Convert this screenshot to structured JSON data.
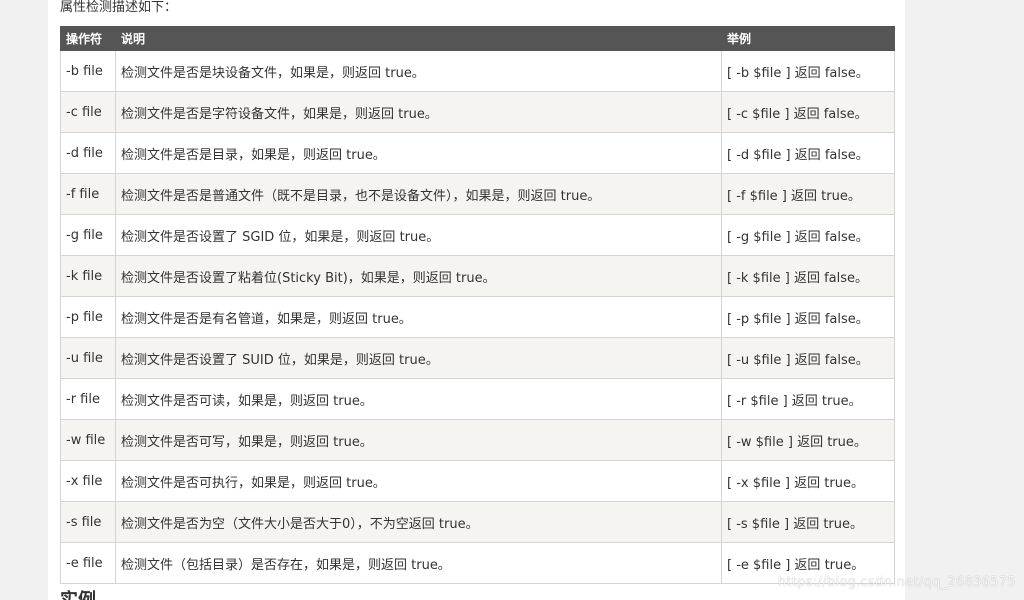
{
  "intro": "属性检测描述如下：",
  "table": {
    "headers": [
      "操作符",
      "说明",
      "举例"
    ],
    "rows": [
      {
        "op": "-b file",
        "desc": "检测文件是否是块设备文件，如果是，则返回 true。",
        "example": "[ -b $file ] 返回 false。"
      },
      {
        "op": "-c file",
        "desc": "检测文件是否是字符设备文件，如果是，则返回 true。",
        "example": "[ -c $file ] 返回 false。"
      },
      {
        "op": "-d file",
        "desc": "检测文件是否是目录，如果是，则返回 true。",
        "example": "[ -d $file ] 返回 false。"
      },
      {
        "op": "-f file",
        "desc": "检测文件是否是普通文件（既不是目录，也不是设备文件），如果是，则返回 true。",
        "example": "[ -f $file ] 返回 true。"
      },
      {
        "op": "-g file",
        "desc": "检测文件是否设置了 SGID 位，如果是，则返回 true。",
        "example": "[ -g $file ] 返回 false。"
      },
      {
        "op": "-k file",
        "desc": "检测文件是否设置了粘着位(Sticky Bit)，如果是，则返回 true。",
        "example": "[ -k $file ] 返回 false。"
      },
      {
        "op": "-p file",
        "desc": "检测文件是否是有名管道，如果是，则返回 true。",
        "example": "[ -p $file ] 返回 false。"
      },
      {
        "op": "-u file",
        "desc": "检测文件是否设置了 SUID 位，如果是，则返回 true。",
        "example": "[ -u $file ] 返回 false。"
      },
      {
        "op": "-r file",
        "desc": "检测文件是否可读，如果是，则返回 true。",
        "example": "[ -r $file ] 返回 true。"
      },
      {
        "op": "-w file",
        "desc": "检测文件是否可写，如果是，则返回 true。",
        "example": "[ -w $file ] 返回 true。"
      },
      {
        "op": "-x file",
        "desc": "检测文件是否可执行，如果是，则返回 true。",
        "example": "[ -x $file ] 返回 true。"
      },
      {
        "op": "-s file",
        "desc": "检测文件是否为空（文件大小是否大于0），不为空返回 true。",
        "example": "[ -s $file ] 返回 true。"
      },
      {
        "op": "-e file",
        "desc": "检测文件（包括目录）是否存在，如果是，则返回 true。",
        "example": "[ -e $file ] 返回 true。"
      }
    ]
  },
  "next_heading": "实例",
  "watermark": "https://blog.csdn.net/qq_26836575",
  "colors": {
    "header_bg": "#555555",
    "row_alt_bg": "#f6f4f0",
    "page_bg": "#f1f1f1"
  }
}
